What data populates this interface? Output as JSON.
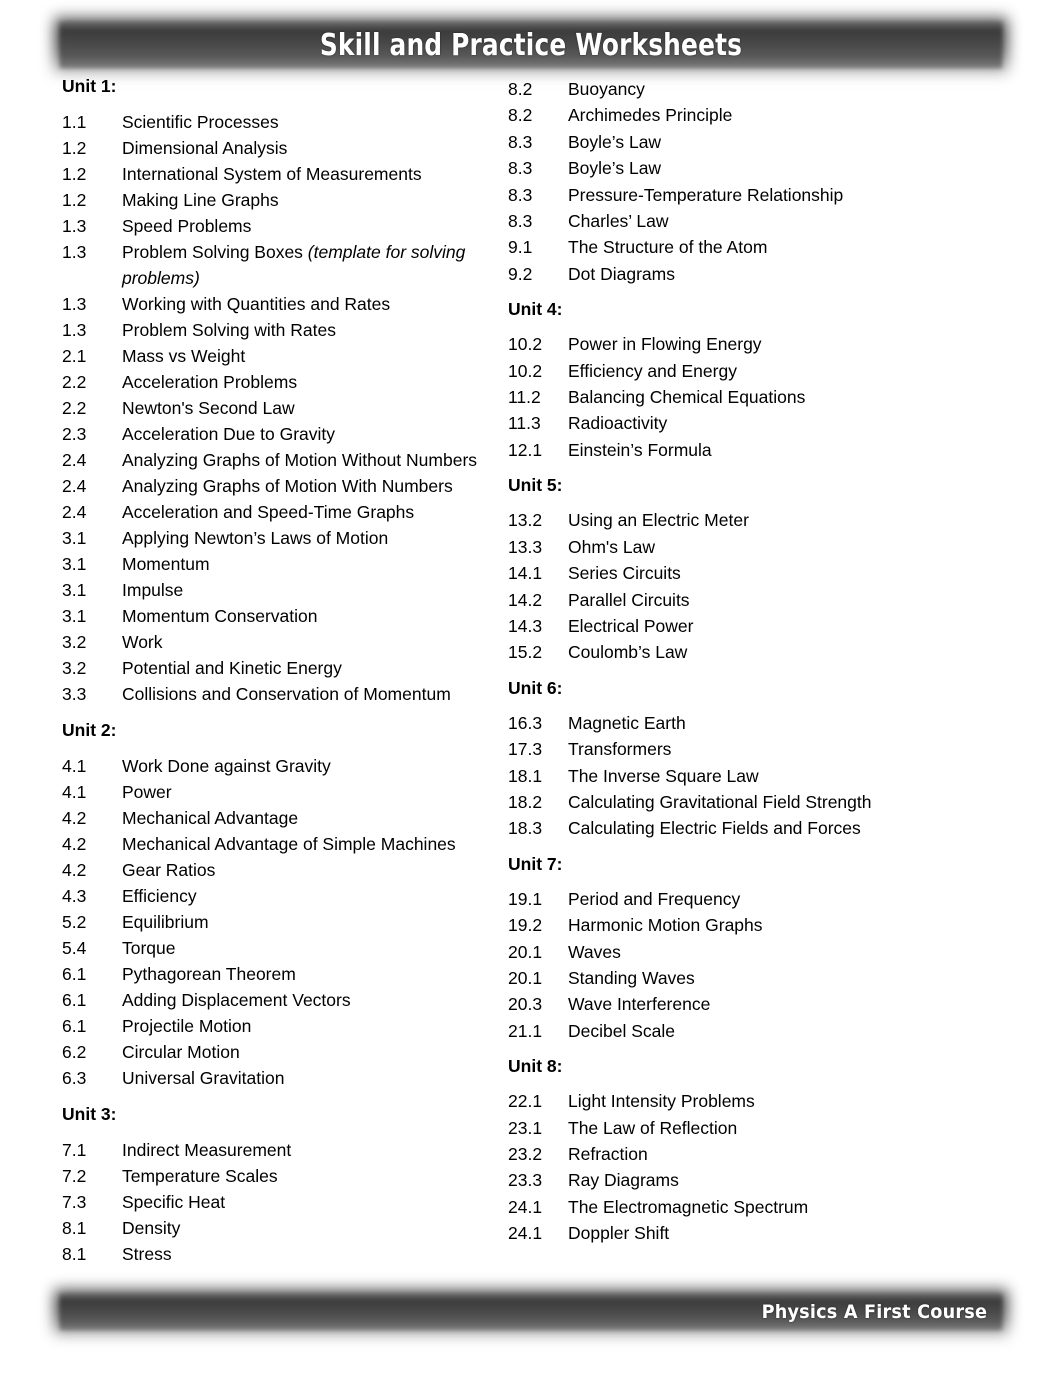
{
  "document": {
    "header_title": "Skill and Practice Worksheets",
    "footer_title": "Physics A First Course"
  },
  "left_column": [
    {
      "type": "heading",
      "label": "Unit 1:"
    },
    {
      "type": "entry",
      "num": "1.1",
      "title": "Scientific Processes"
    },
    {
      "type": "entry",
      "num": "1.2",
      "title": "Dimensional Analysis"
    },
    {
      "type": "entry",
      "num": "1.2",
      "title": "International System of Measurements"
    },
    {
      "type": "entry",
      "num": "1.2",
      "title": "Making Line Graphs"
    },
    {
      "type": "entry",
      "num": "1.3",
      "title": "Speed Problems"
    },
    {
      "type": "entry",
      "num": "1.3",
      "title": "Problem Solving Boxes ",
      "italic": "(template for solving problems)"
    },
    {
      "type": "entry",
      "num": "1.3",
      "title": "Working with Quantities and Rates"
    },
    {
      "type": "entry",
      "num": "1.3",
      "title": "Problem Solving with Rates"
    },
    {
      "type": "entry",
      "num": "2.1",
      "title": "Mass vs Weight"
    },
    {
      "type": "entry",
      "num": "2.2",
      "title": "Acceleration Problems"
    },
    {
      "type": "entry",
      "num": "2.2",
      "title": "Newton's Second Law"
    },
    {
      "type": "entry",
      "num": "2.3",
      "title": "Acceleration Due to Gravity"
    },
    {
      "type": "entry",
      "num": "2.4",
      "title": "Analyzing Graphs of Motion Without Numbers"
    },
    {
      "type": "entry",
      "num": "2.4",
      "title": "Analyzing Graphs of Motion With Numbers"
    },
    {
      "type": "entry",
      "num": "2.4",
      "title": "Acceleration and Speed-Time Graphs"
    },
    {
      "type": "entry",
      "num": "3.1",
      "title": "Applying Newton’s Laws of Motion"
    },
    {
      "type": "entry",
      "num": "3.1",
      "title": "Momentum"
    },
    {
      "type": "entry",
      "num": "3.1",
      "title": "Impulse"
    },
    {
      "type": "entry",
      "num": "3.1",
      "title": "Momentum Conservation"
    },
    {
      "type": "entry",
      "num": "3.2",
      "title": "Work"
    },
    {
      "type": "entry",
      "num": "3.2",
      "title": "Potential and Kinetic Energy"
    },
    {
      "type": "entry",
      "num": "3.3",
      "title": "Collisions and Conservation of Momentum"
    },
    {
      "type": "heading",
      "label": "Unit 2:"
    },
    {
      "type": "entry",
      "num": "4.1",
      "title": "Work Done against Gravity"
    },
    {
      "type": "entry",
      "num": "4.1",
      "title": "Power"
    },
    {
      "type": "entry",
      "num": "4.2",
      "title": "Mechanical Advantage"
    },
    {
      "type": "entry",
      "num": "4.2",
      "title": "Mechanical Advantage of Simple Machines"
    },
    {
      "type": "entry",
      "num": "4.2",
      "title": "Gear Ratios"
    },
    {
      "type": "entry",
      "num": "4.3",
      "title": "Efficiency"
    },
    {
      "type": "entry",
      "num": "5.2",
      "title": "Equilibrium"
    },
    {
      "type": "entry",
      "num": "5.4",
      "title": "Torque"
    },
    {
      "type": "entry",
      "num": "6.1",
      "title": "Pythagorean Theorem"
    },
    {
      "type": "entry",
      "num": "6.1",
      "title": "Adding Displacement Vectors"
    },
    {
      "type": "entry",
      "num": "6.1",
      "title": "Projectile Motion"
    },
    {
      "type": "entry",
      "num": "6.2",
      "title": "Circular Motion"
    },
    {
      "type": "entry",
      "num": "6.3",
      "title": "Universal Gravitation"
    },
    {
      "type": "heading",
      "label": "Unit 3:"
    },
    {
      "type": "entry",
      "num": "7.1",
      "title": "Indirect Measurement"
    },
    {
      "type": "entry",
      "num": "7.2",
      "title": "Temperature Scales"
    },
    {
      "type": "entry",
      "num": "7.3",
      "title": "Specific Heat"
    },
    {
      "type": "entry",
      "num": "8.1",
      "title": "Density"
    },
    {
      "type": "entry",
      "num": "8.1",
      "title": "Stress"
    }
  ],
  "right_column": [
    {
      "type": "entry",
      "num": "8.2",
      "title": "Buoyancy"
    },
    {
      "type": "entry",
      "num": "8.2",
      "title": "Archimedes Principle"
    },
    {
      "type": "entry",
      "num": "8.3",
      "title": "Boyle’s Law"
    },
    {
      "type": "entry",
      "num": "8.3",
      "title": "Boyle’s Law"
    },
    {
      "type": "entry",
      "num": "8.3",
      "title": "Pressure-Temperature Relationship"
    },
    {
      "type": "entry",
      "num": "8.3",
      "title": "Charles’ Law"
    },
    {
      "type": "entry",
      "num": "9.1",
      "title": "The Structure of the Atom"
    },
    {
      "type": "entry",
      "num": "9.2",
      "title": "Dot Diagrams"
    },
    {
      "type": "heading",
      "label": "Unit 4:"
    },
    {
      "type": "entry",
      "num": "10.2",
      "title": "Power in Flowing Energy"
    },
    {
      "type": "entry",
      "num": "10.2",
      "title": "Efficiency and Energy"
    },
    {
      "type": "entry",
      "num": "11.2",
      "title": "Balancing Chemical Equations"
    },
    {
      "type": "entry",
      "num": "11.3",
      "title": "Radioactivity"
    },
    {
      "type": "entry",
      "num": "12.1",
      "title": "Einstein’s Formula"
    },
    {
      "type": "heading",
      "label": "Unit 5:"
    },
    {
      "type": "entry",
      "num": "13.2",
      "title": "Using an Electric Meter"
    },
    {
      "type": "entry",
      "num": "13.3",
      "title": "Ohm's Law"
    },
    {
      "type": "entry",
      "num": "14.1",
      "title": "Series Circuits"
    },
    {
      "type": "entry",
      "num": "14.2",
      "title": "Parallel Circuits"
    },
    {
      "type": "entry",
      "num": "14.3",
      "title": "Electrical Power"
    },
    {
      "type": "entry",
      "num": "15.2",
      "title": "Coulomb’s Law"
    },
    {
      "type": "heading",
      "label": "Unit 6:"
    },
    {
      "type": "entry",
      "num": "16.3",
      "title": "Magnetic Earth"
    },
    {
      "type": "entry",
      "num": "17.3",
      "title": "Transformers"
    },
    {
      "type": "entry",
      "num": "18.1",
      "title": "The Inverse Square Law"
    },
    {
      "type": "entry",
      "num": "18.2",
      "title": "Calculating Gravitational Field Strength"
    },
    {
      "type": "entry",
      "num": "18.3",
      "title": "Calculating Electric Fields and Forces"
    },
    {
      "type": "heading",
      "label": "Unit 7:"
    },
    {
      "type": "entry",
      "num": "19.1",
      "title": "Period and Frequency"
    },
    {
      "type": "entry",
      "num": "19.2",
      "title": "Harmonic Motion Graphs"
    },
    {
      "type": "entry",
      "num": "20.1",
      "title": "Waves"
    },
    {
      "type": "entry",
      "num": "20.1",
      "title": "Standing Waves"
    },
    {
      "type": "entry",
      "num": "20.3",
      "title": "Wave Interference"
    },
    {
      "type": "entry",
      "num": "21.1",
      "title": "Decibel Scale"
    },
    {
      "type": "heading",
      "label": "Unit 8:"
    },
    {
      "type": "entry",
      "num": "22.1",
      "title": "Light Intensity Problems"
    },
    {
      "type": "entry",
      "num": "23.1",
      "title": "The Law of Reflection"
    },
    {
      "type": "entry",
      "num": "23.2",
      "title": "Refraction"
    },
    {
      "type": "entry",
      "num": "23.3",
      "title": "Ray Diagrams"
    },
    {
      "type": "entry",
      "num": "24.1",
      "title": "The Electromagnetic Spectrum"
    },
    {
      "type": "entry",
      "num": "24.1",
      "title": "Doppler Shift"
    }
  ]
}
